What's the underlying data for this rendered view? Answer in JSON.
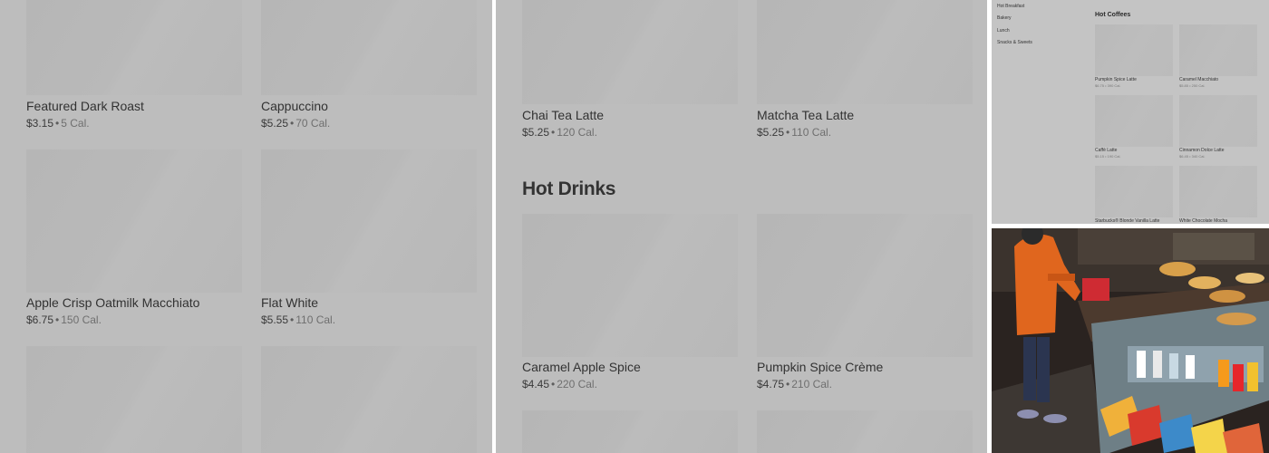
{
  "panel1": {
    "items": [
      {
        "name": "Featured Dark Roast",
        "price": "$3.15",
        "sep": "•",
        "cal": "5 Cal."
      },
      {
        "name": "Cappuccino",
        "price": "$5.25",
        "sep": "•",
        "cal": "70 Cal."
      },
      {
        "name": "Apple Crisp Oatmilk Macchiato",
        "price": "$6.75",
        "sep": "•",
        "cal": "150 Cal."
      },
      {
        "name": "Flat White",
        "price": "$5.55",
        "sep": "•",
        "cal": "110 Cal."
      }
    ]
  },
  "panel2": {
    "items": [
      {
        "name": "Chai Tea Latte",
        "price": "$5.25",
        "sep": "•",
        "cal": "120 Cal."
      },
      {
        "name": "Matcha Tea Latte",
        "price": "$5.25",
        "sep": "•",
        "cal": "110 Cal."
      },
      {
        "name": "Caramel Apple Spice",
        "price": "$4.45",
        "sep": "•",
        "cal": "220 Cal."
      },
      {
        "name": "Pumpkin Spice Crème",
        "price": "$4.75",
        "sep": "•",
        "cal": "210 Cal."
      }
    ],
    "section_title": "Hot Drinks"
  },
  "panel3": {
    "nav": [
      "Hot Breakfast",
      "Bakery",
      "Lunch",
      "Snacks & Sweets"
    ],
    "section_title": "Hot Coffees",
    "items": [
      {
        "name": "Pumpkin Spice Latte",
        "meta": "$6.75 • 390 Cal."
      },
      {
        "name": "Caramel Macchiato",
        "meta": "$5.85 • 250 Cal."
      },
      {
        "name": "Caffè Latte",
        "meta": "$5.15 • 190 Cal."
      },
      {
        "name": "Cinnamon Dolce Latte",
        "meta": "$6.45 • 340 Cal."
      },
      {
        "name": "Starbucks® Blonde Vanilla Latte",
        "meta": ""
      },
      {
        "name": "White Chocolate Mocha",
        "meta": ""
      }
    ]
  }
}
